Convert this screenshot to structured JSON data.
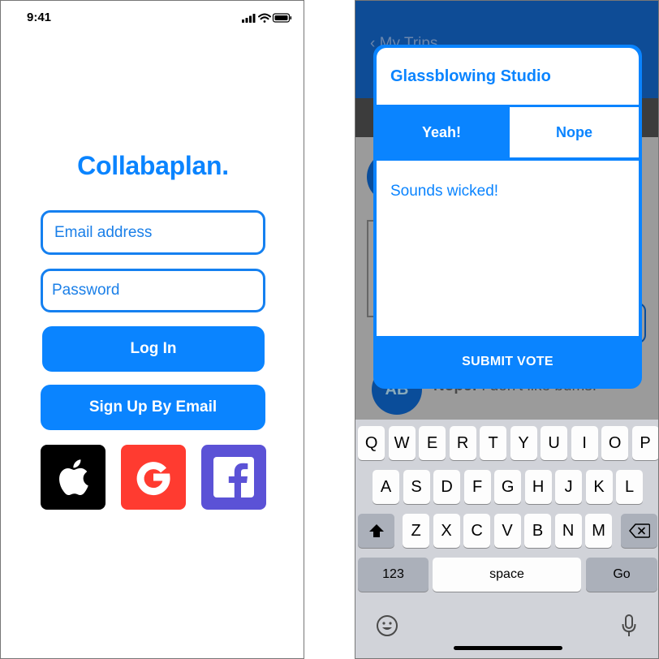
{
  "left_screen": {
    "status_time": "9:41",
    "app_title": "Collabaplan.",
    "email_placeholder": "Email address",
    "password_placeholder": "Password",
    "login_label": "Log In",
    "signup_label": "Sign Up By Email",
    "social_buttons": [
      {
        "name": "apple-icon",
        "color": "#000000"
      },
      {
        "name": "google-icon",
        "color": "#ff3b30"
      },
      {
        "name": "facebook-icon",
        "color": "#5b52d6"
      }
    ],
    "colors": {
      "accent": "#0a84ff"
    }
  },
  "right_screen": {
    "nav_back_label": "My Trips",
    "avatar_initials": "AB",
    "bg_message_bold": "Nope:",
    "bg_message_text": " I don't like bums.",
    "modal": {
      "title": "Glassblowing Studio",
      "vote_yes": "Yeah!",
      "vote_no": "Nope",
      "comment": "Sounds wicked!",
      "submit_label": "SUBMIT VOTE"
    },
    "keyboard": {
      "row1": [
        "Q",
        "W",
        "E",
        "R",
        "T",
        "Y",
        "U",
        "I",
        "O",
        "P"
      ],
      "row2": [
        "A",
        "S",
        "D",
        "F",
        "G",
        "H",
        "J",
        "K",
        "L"
      ],
      "row3": [
        "Z",
        "X",
        "C",
        "V",
        "B",
        "N",
        "M"
      ],
      "numbers_label": "123",
      "space_label": "space",
      "go_label": "Go"
    },
    "colors": {
      "nav": "#0e4c96",
      "accent": "#0a84ff",
      "keyboard": "#d1d3d9"
    }
  }
}
